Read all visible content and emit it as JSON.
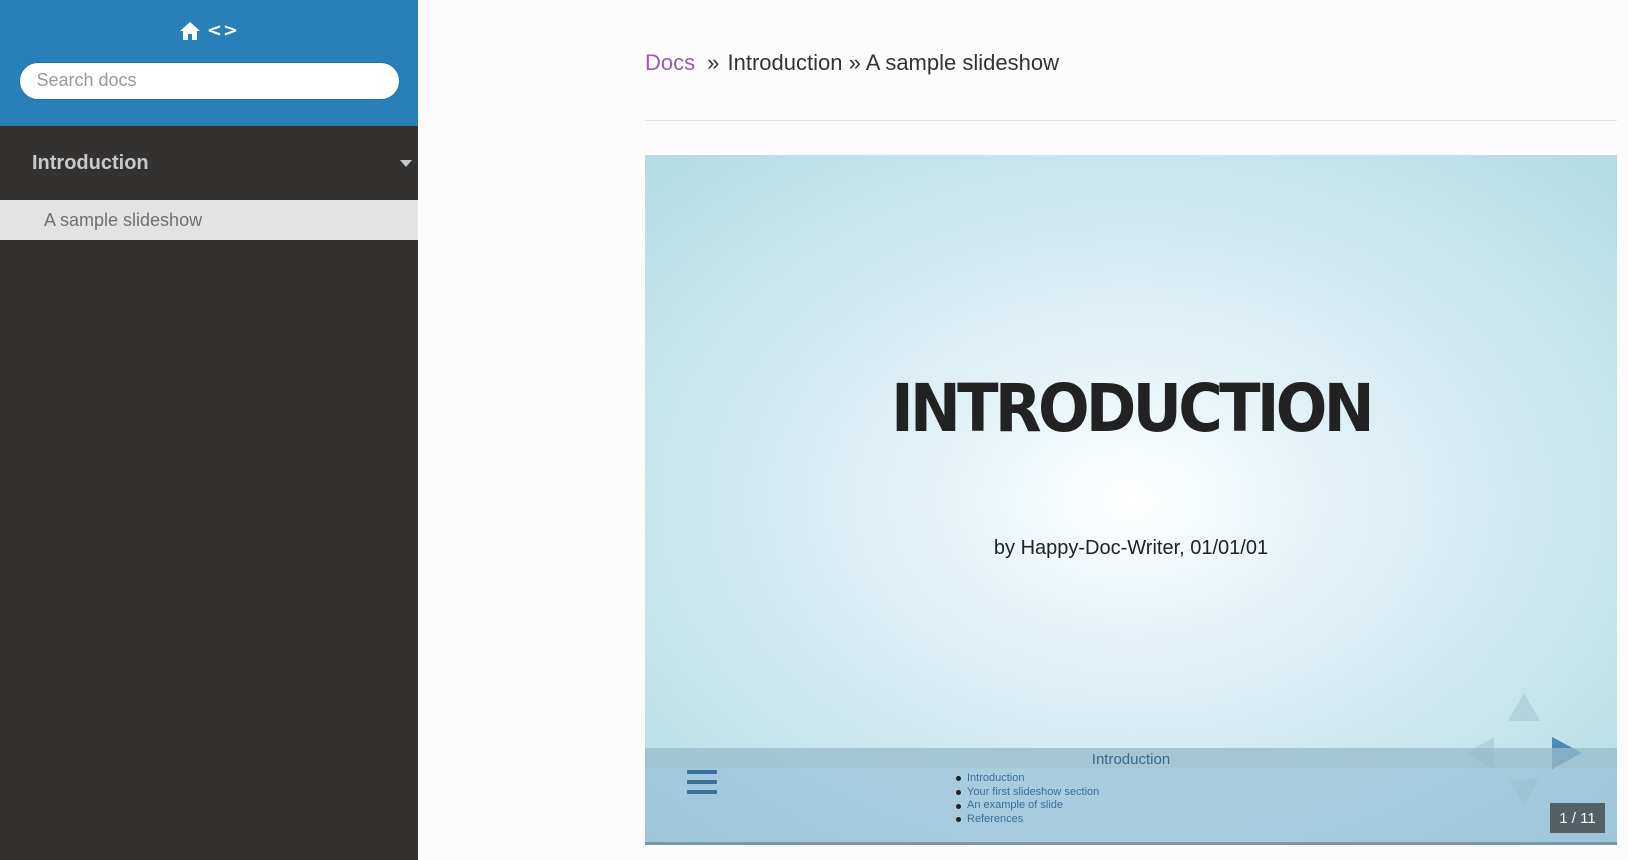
{
  "sidebar": {
    "home_glyph": "<>",
    "search": {
      "placeholder": "Search docs",
      "value": ""
    },
    "section": {
      "label": "Introduction"
    },
    "items": [
      {
        "label": "A sample slideshow"
      }
    ]
  },
  "breadcrumb": {
    "root": "Docs",
    "sep1": "»",
    "level1": "Introduction",
    "sep2": "»",
    "level2": "A sample slideshow"
  },
  "slide": {
    "title": "INTRODUCTION",
    "byline": "by Happy-Doc-Writer, 01/01/01",
    "footer_heading": "Introduction",
    "toc": [
      "Introduction",
      "Your first slideshow section",
      "An example of slide",
      "References"
    ],
    "counter": "1 / 11",
    "current_slide": 1,
    "total_slides": 11
  },
  "colors": {
    "sidebar_top": "#2980b9",
    "sidebar_bg": "#343131",
    "link": "#9b59b6",
    "accent": "#4a8bb3"
  }
}
